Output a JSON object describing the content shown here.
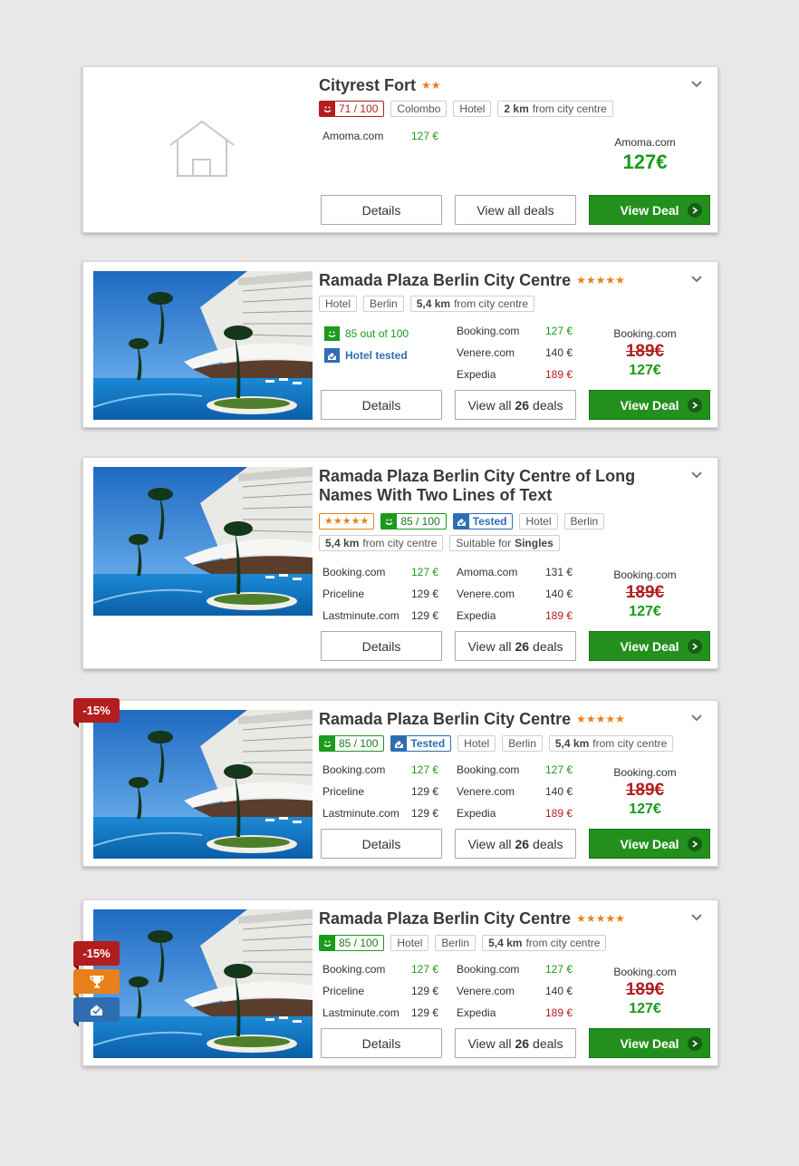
{
  "colors": {
    "green": "#1a9b1a",
    "red": "#b21e1e",
    "orange": "#e8801b",
    "blue": "#2f6db3",
    "deal_button": "#23901e"
  },
  "buttons": {
    "details": "Details",
    "view_all": "View all deals",
    "view_all_prefix": "View all",
    "view_all_count": "26",
    "view_all_suffix": "deals",
    "view_deal": "View Deal"
  },
  "cards": [
    {
      "name": "Cityrest Fort",
      "stars": "★★",
      "rating": "71 / 100",
      "tags": [
        "Colombo",
        "Hotel"
      ],
      "distance": {
        "km": "2 km",
        "text": "from city centre"
      },
      "prices": [
        {
          "provider": "Amoma.com",
          "price": "127 €"
        }
      ],
      "best_provider": "Amoma.com",
      "best_price": "127€"
    },
    {
      "name": "Ramada Plaza Berlin City Centre",
      "stars": "★★★★★",
      "tags": [
        "Hotel",
        "Berlin"
      ],
      "distance": {
        "km": "5,4 km",
        "text": "from city centre"
      },
      "rating_text": "85 out of 100",
      "tested_text": "Hotel tested",
      "prices": [
        {
          "provider": "Booking.com",
          "price": "127 €"
        },
        {
          "provider": "Venere.com",
          "price": "140 €"
        },
        {
          "provider": "Expedia",
          "price": "189 €"
        }
      ],
      "best_provider": "Booking.com",
      "old_price": "189€",
      "best_price": "127€"
    },
    {
      "name": "Ramada Plaza Berlin City Centre of Long Names With Two Lines of Text",
      "stars": "★★★★★",
      "rating": "85 / 100",
      "tested": "Tested",
      "tags": [
        "Hotel",
        "Berlin"
      ],
      "distance": {
        "km": "5,4 km",
        "text": "from city centre"
      },
      "suitable": {
        "text": "Suitable for",
        "bold": "Singles"
      },
      "prices_left": [
        {
          "provider": "Booking.com",
          "price": "127 €"
        },
        {
          "provider": "Priceline",
          "price": "129 €"
        },
        {
          "provider": "Lastminute.com",
          "price": "129 €"
        }
      ],
      "prices_right": [
        {
          "provider": "Amoma.com",
          "price": "131 €"
        },
        {
          "provider": "Venere.com",
          "price": "140 €"
        },
        {
          "provider": "Expedia",
          "price": "189 €"
        }
      ],
      "best_provider": "Booking.com",
      "old_price": "189€",
      "best_price": "127€"
    },
    {
      "name": "Ramada Plaza Berlin City Centre",
      "stars": "★★★★★",
      "discount": "-15%",
      "rating": "85 / 100",
      "tested": "Tested",
      "tags": [
        "Hotel",
        "Berlin"
      ],
      "distance": {
        "km": "5,4 km",
        "text": "from city centre"
      },
      "prices_left": [
        {
          "provider": "Booking.com",
          "price": "127 €"
        },
        {
          "provider": "Priceline",
          "price": "129 €"
        },
        {
          "provider": "Lastminute.com",
          "price": "129 €"
        }
      ],
      "prices_right": [
        {
          "provider": "Booking.com",
          "price": "127 €"
        },
        {
          "provider": "Venere.com",
          "price": "140 €"
        },
        {
          "provider": "Expedia",
          "price": "189 €"
        }
      ],
      "best_provider": "Booking.com",
      "old_price": "189€",
      "best_price": "127€"
    },
    {
      "name": "Ramada Plaza Berlin City Centre",
      "stars": "★★★★★",
      "discount": "-15%",
      "badges": [
        "trophy-icon",
        "hotel-tested-icon"
      ],
      "rating": "85 / 100",
      "tags": [
        "Hotel",
        "Berlin"
      ],
      "distance": {
        "km": "5,4 km",
        "text": "from city centre"
      },
      "prices_left": [
        {
          "provider": "Booking.com",
          "price": "127 €"
        },
        {
          "provider": "Priceline",
          "price": "129 €"
        },
        {
          "provider": "Lastminute.com",
          "price": "129 €"
        }
      ],
      "prices_right": [
        {
          "provider": "Booking.com",
          "price": "127 €"
        },
        {
          "provider": "Venere.com",
          "price": "140 €"
        },
        {
          "provider": "Expedia",
          "price": "189 €"
        }
      ],
      "best_provider": "Booking.com",
      "old_price": "189€",
      "best_price": "127€"
    }
  ]
}
